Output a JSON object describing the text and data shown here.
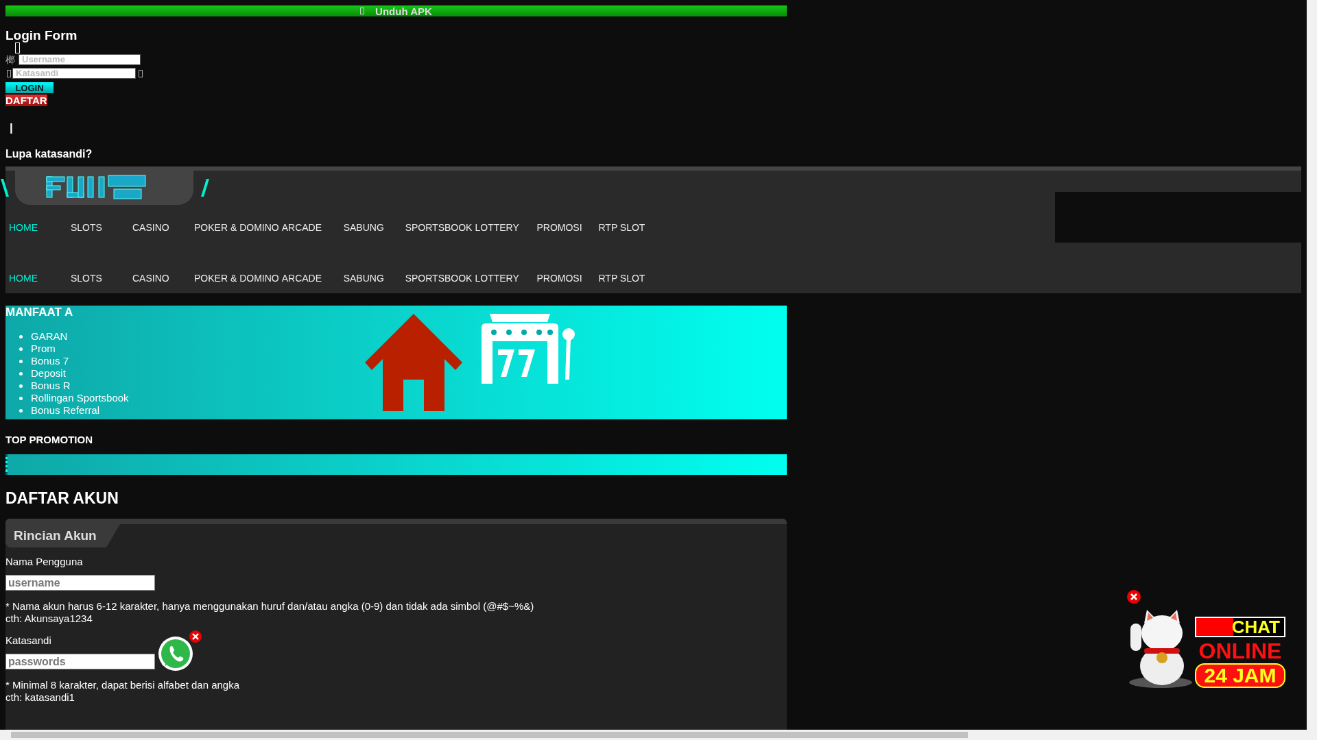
{
  "download_bar": {
    "label": "Unduh APK"
  },
  "login_form": {
    "title": "Login Form",
    "username_prefix": "榔",
    "username": {
      "placeholder": "Username"
    },
    "password": {
      "placeholder": "Katasandi"
    },
    "login_button": "LOGIN",
    "register_button": "DAFTAR",
    "separator": "|",
    "forgot_link": "Lupa katasandi?"
  },
  "nav_rows": [
    {
      "items": [
        {
          "label": "HOME",
          "selected": true
        },
        {
          "label": "SLOTS",
          "selected": false
        },
        {
          "label": "CASINO",
          "selected": false
        },
        {
          "label": "POKER & DOMINO",
          "selected": false
        },
        {
          "label": "ARCADE",
          "selected": false
        },
        {
          "label": "SABUNG",
          "selected": false
        },
        {
          "label": "SPORTSBOOK",
          "selected": false
        },
        {
          "label": "LOTTERY",
          "selected": false
        },
        {
          "label": "PROMOSI",
          "selected": false
        },
        {
          "label": "RTP SLOT",
          "selected": false
        }
      ]
    },
    {
      "items": [
        {
          "label": "HOME",
          "selected": true
        },
        {
          "label": "SLOTS",
          "selected": false
        },
        {
          "label": "CASINO",
          "selected": false
        },
        {
          "label": "POKER & DOMINO",
          "selected": false
        },
        {
          "label": "ARCADE",
          "selected": false
        },
        {
          "label": "SABUNG",
          "selected": false
        },
        {
          "label": "SPORTSBOOK",
          "selected": false
        },
        {
          "label": "LOTTERY",
          "selected": false
        },
        {
          "label": "PROMOSI",
          "selected": false
        },
        {
          "label": "RTP SLOT",
          "selected": false
        }
      ]
    }
  ],
  "benefits": {
    "title": "MANFAAT A",
    "items": [
      "GARAN",
      "Prom",
      "Bonus 7",
      "Deposit",
      "Bonus R",
      "Rollingan Sportsbook",
      "Bonus Referral"
    ]
  },
  "top_promotion": {
    "title": "TOP PROMOTION"
  },
  "register": {
    "title": "DAFTAR AKUN",
    "tab": "Rincian Akun",
    "fields": [
      {
        "kind": "text",
        "label": "Nama Pengguna",
        "placeholder": "username",
        "notes": [
          "* Nama akun harus 6-12 karakter, hanya menggunakan huruf dan/atau angka (0-9) dan tidak ada simbol (@#$~%&)",
          "cth: Akunsaya1234"
        ]
      },
      {
        "kind": "password",
        "label": "Katasandi",
        "placeholder": "passwords",
        "notes": [
          "* Minimal 8 karakter, dapat berisi alfabet dan angka",
          "cth: katasandi1"
        ]
      }
    ]
  },
  "chat_widget": {
    "lines": [
      "CHAT",
      "ONLINE",
      "24 JAM"
    ]
  }
}
